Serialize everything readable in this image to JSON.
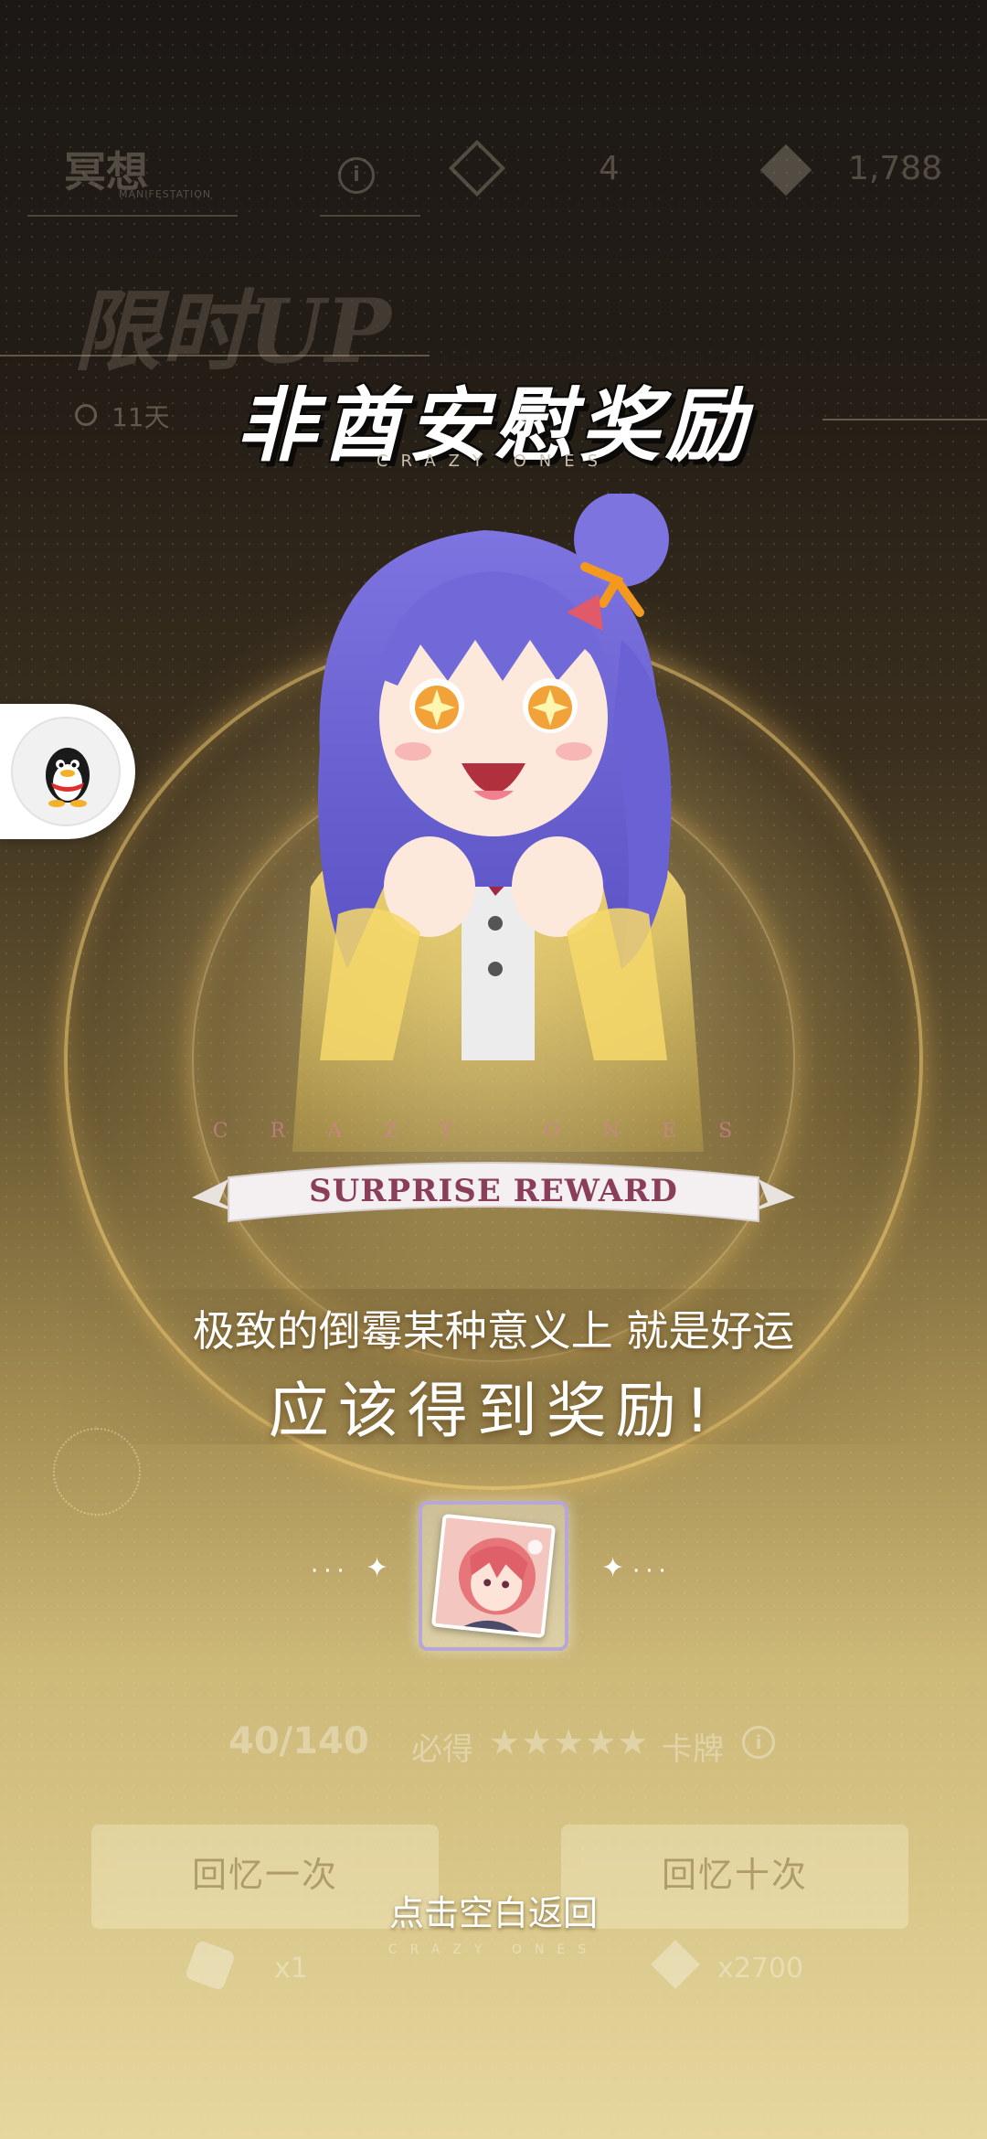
{
  "background_header": {
    "logo_text": "冥想",
    "logo_sub": "MANIFESTATION",
    "info_glyph": "i",
    "currency_a_count": "4",
    "currency_b_count": "1,788",
    "banner_text": "限时UP",
    "days_left": "11天"
  },
  "title": {
    "main": "非酋安慰奖励",
    "sub": "CRAZY ONES"
  },
  "ribbon": {
    "arc_text": "CRAZY ONES",
    "label": "SURPRISE REWARD"
  },
  "captions": {
    "line1": "极致的倒霉某种意义上 就是好运",
    "line2": "应该得到奖励!"
  },
  "reward": {
    "item_name": "reward-card"
  },
  "gacha": {
    "count": "40/140",
    "guarantee_label": "必得",
    "stars": "★★★★★",
    "card_word": "卡牌",
    "info_glyph": "i",
    "btn_single": "回忆一次",
    "btn_ten": "回忆十次",
    "cost_single": "x1",
    "cost_ten": "x2700",
    "crazy_small": "CRAZY ONES"
  },
  "hint": {
    "back": "点击空白返回"
  },
  "colors": {
    "ribbon_text": "#8a3e5a",
    "card_border": "#b7a6d8",
    "title": "#ffffff"
  }
}
